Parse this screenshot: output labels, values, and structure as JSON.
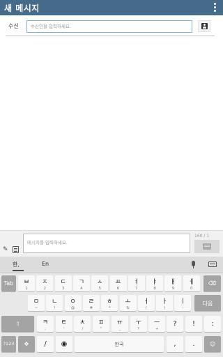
{
  "action_bar": {
    "title": "새 메시지"
  },
  "recipient": {
    "label": "수신",
    "placeholder": "수신인을 입력하세요."
  },
  "compose": {
    "placeholder": "메시지를 입력하세요.",
    "counter": "160 / 1"
  },
  "keyboard": {
    "lang_ko": "한,",
    "lang_en": "En",
    "row1": [
      {
        "main": "ㅂ",
        "sub": "1"
      },
      {
        "main": "ㅈ",
        "sub": "2"
      },
      {
        "main": "ㄷ",
        "sub": "3"
      },
      {
        "main": "ㄱ",
        "sub": "4"
      },
      {
        "main": "ㅅ",
        "sub": "5"
      },
      {
        "main": "ㅛ",
        "sub": "6"
      },
      {
        "main": "ㅕ",
        "sub": "7"
      },
      {
        "main": "ㅑ",
        "sub": "8"
      },
      {
        "main": "ㅐ",
        "sub": "9"
      },
      {
        "main": "ㅔ",
        "sub": "0"
      }
    ],
    "row2": [
      {
        "main": "ㅁ",
        "sub": "~"
      },
      {
        "main": "ㄴ",
        "sub": "!"
      },
      {
        "main": "ㅇ",
        "sub": "@"
      },
      {
        "main": "ㄹ",
        "sub": "#"
      },
      {
        "main": "ㅎ",
        "sub": "*"
      },
      {
        "main": "ㅗ",
        "sub": "&"
      },
      {
        "main": "ㅓ",
        "sub": "("
      },
      {
        "main": "ㅏ",
        "sub": ")"
      },
      {
        "main": "ㅣ",
        "sub": "-"
      }
    ],
    "row3": [
      {
        "main": "ㅋ",
        "sub": ";"
      },
      {
        "main": "ㅌ",
        "sub": "'"
      },
      {
        "main": "ㅊ",
        "sub": "/"
      },
      {
        "main": "ㅍ",
        "sub": "\""
      },
      {
        "main": "ㅠ",
        "sub": "_"
      },
      {
        "main": "ㅜ",
        "sub": "?"
      },
      {
        "main": "ㅡ",
        "sub": "+"
      }
    ],
    "tab_label": "Tab",
    "enter_label": "다음",
    "shift_glyph": "⇧",
    "backspace_glyph": "⌫",
    "question_label": "?",
    "exclaim_label": "!",
    "colon_label": ":",
    "sym_label": "?123",
    "cursor_glyph": "✥",
    "slash_label": "/",
    "globe_glyph": "◉",
    "space_label": "한국",
    "comma_label": ",",
    "period_label": ".",
    "emoji_glyph": "☺"
  }
}
